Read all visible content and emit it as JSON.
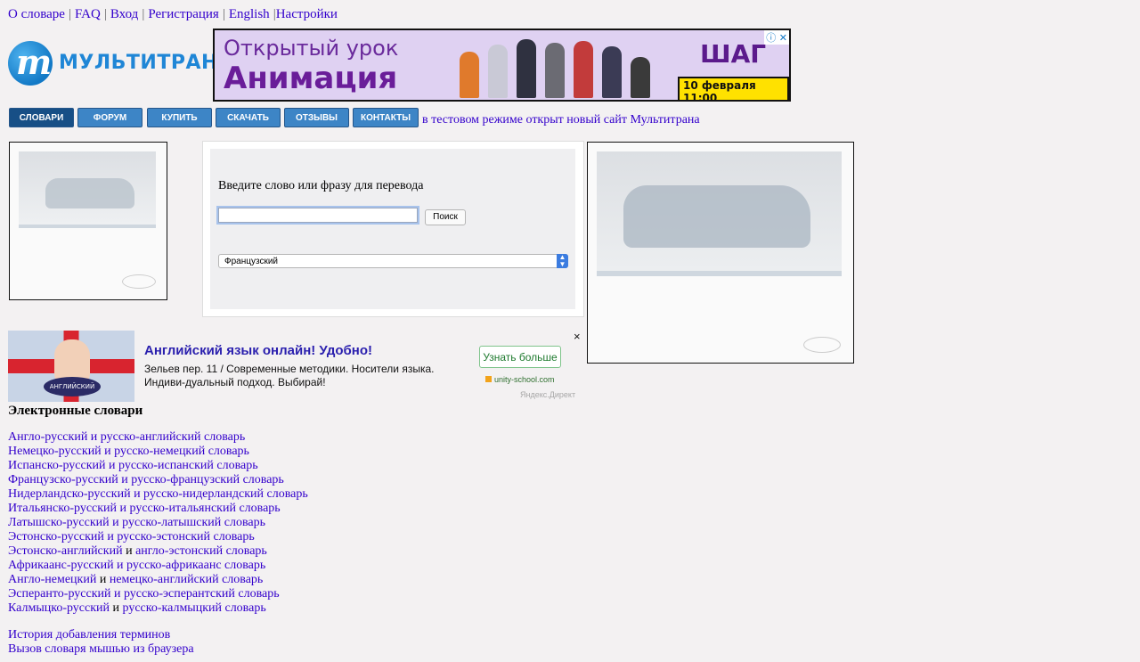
{
  "topnav": {
    "items": [
      "О словаре",
      "FAQ",
      "Вход",
      "Регистрация",
      "English",
      "Настройки"
    ]
  },
  "logo": {
    "mark": "m",
    "text": "МУЛЬТИТРАН"
  },
  "banner": {
    "line1": "Открытый урок",
    "line2": "Анимация",
    "brand": "ШАГ",
    "date": "10 февраля 11:00",
    "icons": "ⓘ ✕"
  },
  "tabs": [
    "СЛОВАРИ",
    "ФОРУМ",
    "КУПИТЬ",
    "СКАЧАТЬ",
    "ОТЗЫВЫ",
    "КОНТАКТЫ"
  ],
  "tab_note": "в тестовом режиме открыт новый сайт Мультитрана",
  "search": {
    "label": "Введите слово или фразу для перевода",
    "input_value": "",
    "button": "Поиск",
    "language": "Французский"
  },
  "yandex_ad": {
    "image_badge": "АНГЛИЙСКИЙ",
    "title": "Английский язык онлайн! Удобно!",
    "text": "Зельев пер. 11 / Современные методики. Носители языка. Индиви-дуальный подход. Выбирай!",
    "button": "Узнать больше",
    "domain": "unity-school.com",
    "source": "Яндекс.Директ",
    "close": "×"
  },
  "dictionaries": {
    "heading": "Электронные словари",
    "items": [
      {
        "a": "Англо-русский и русско-английский словарь"
      },
      {
        "a": "Немецко-русский и русско-немецкий словарь"
      },
      {
        "a": "Испанско-русский и русско-испанский словарь"
      },
      {
        "a": "Французско-русский и русско-французский словарь"
      },
      {
        "a": "Нидерландско-русский и русско-нидерландский словарь"
      },
      {
        "a": "Итальянско-русский и русско-итальянский словарь"
      },
      {
        "a": "Латышско-русский и русско-латышский словарь"
      },
      {
        "a": "Эстонско-русский и русско-эстонский словарь"
      },
      {
        "a": "Эстонско-английский",
        "conj": " и ",
        "b": "англо-эстонский словарь"
      },
      {
        "a": "Африкаанс-русский и русско-африкаанс словарь"
      },
      {
        "a": "Англо-немецкий",
        "conj": " и ",
        "b": "немецко-английский словарь"
      },
      {
        "a": "Эсперанто-русский и русско-эсперантский словарь"
      },
      {
        "a": "Калмыцко-русский",
        "conj": " и ",
        "b": "русско-калмыцкий словарь"
      }
    ]
  },
  "extra_links": [
    "История добавления терминов",
    "Вызов словаря мышью из браузера"
  ],
  "colors": {
    "link": "#3300cc",
    "tab": "#3d85c6",
    "tab_active": "#174f86",
    "brand": "#1f86d6"
  }
}
